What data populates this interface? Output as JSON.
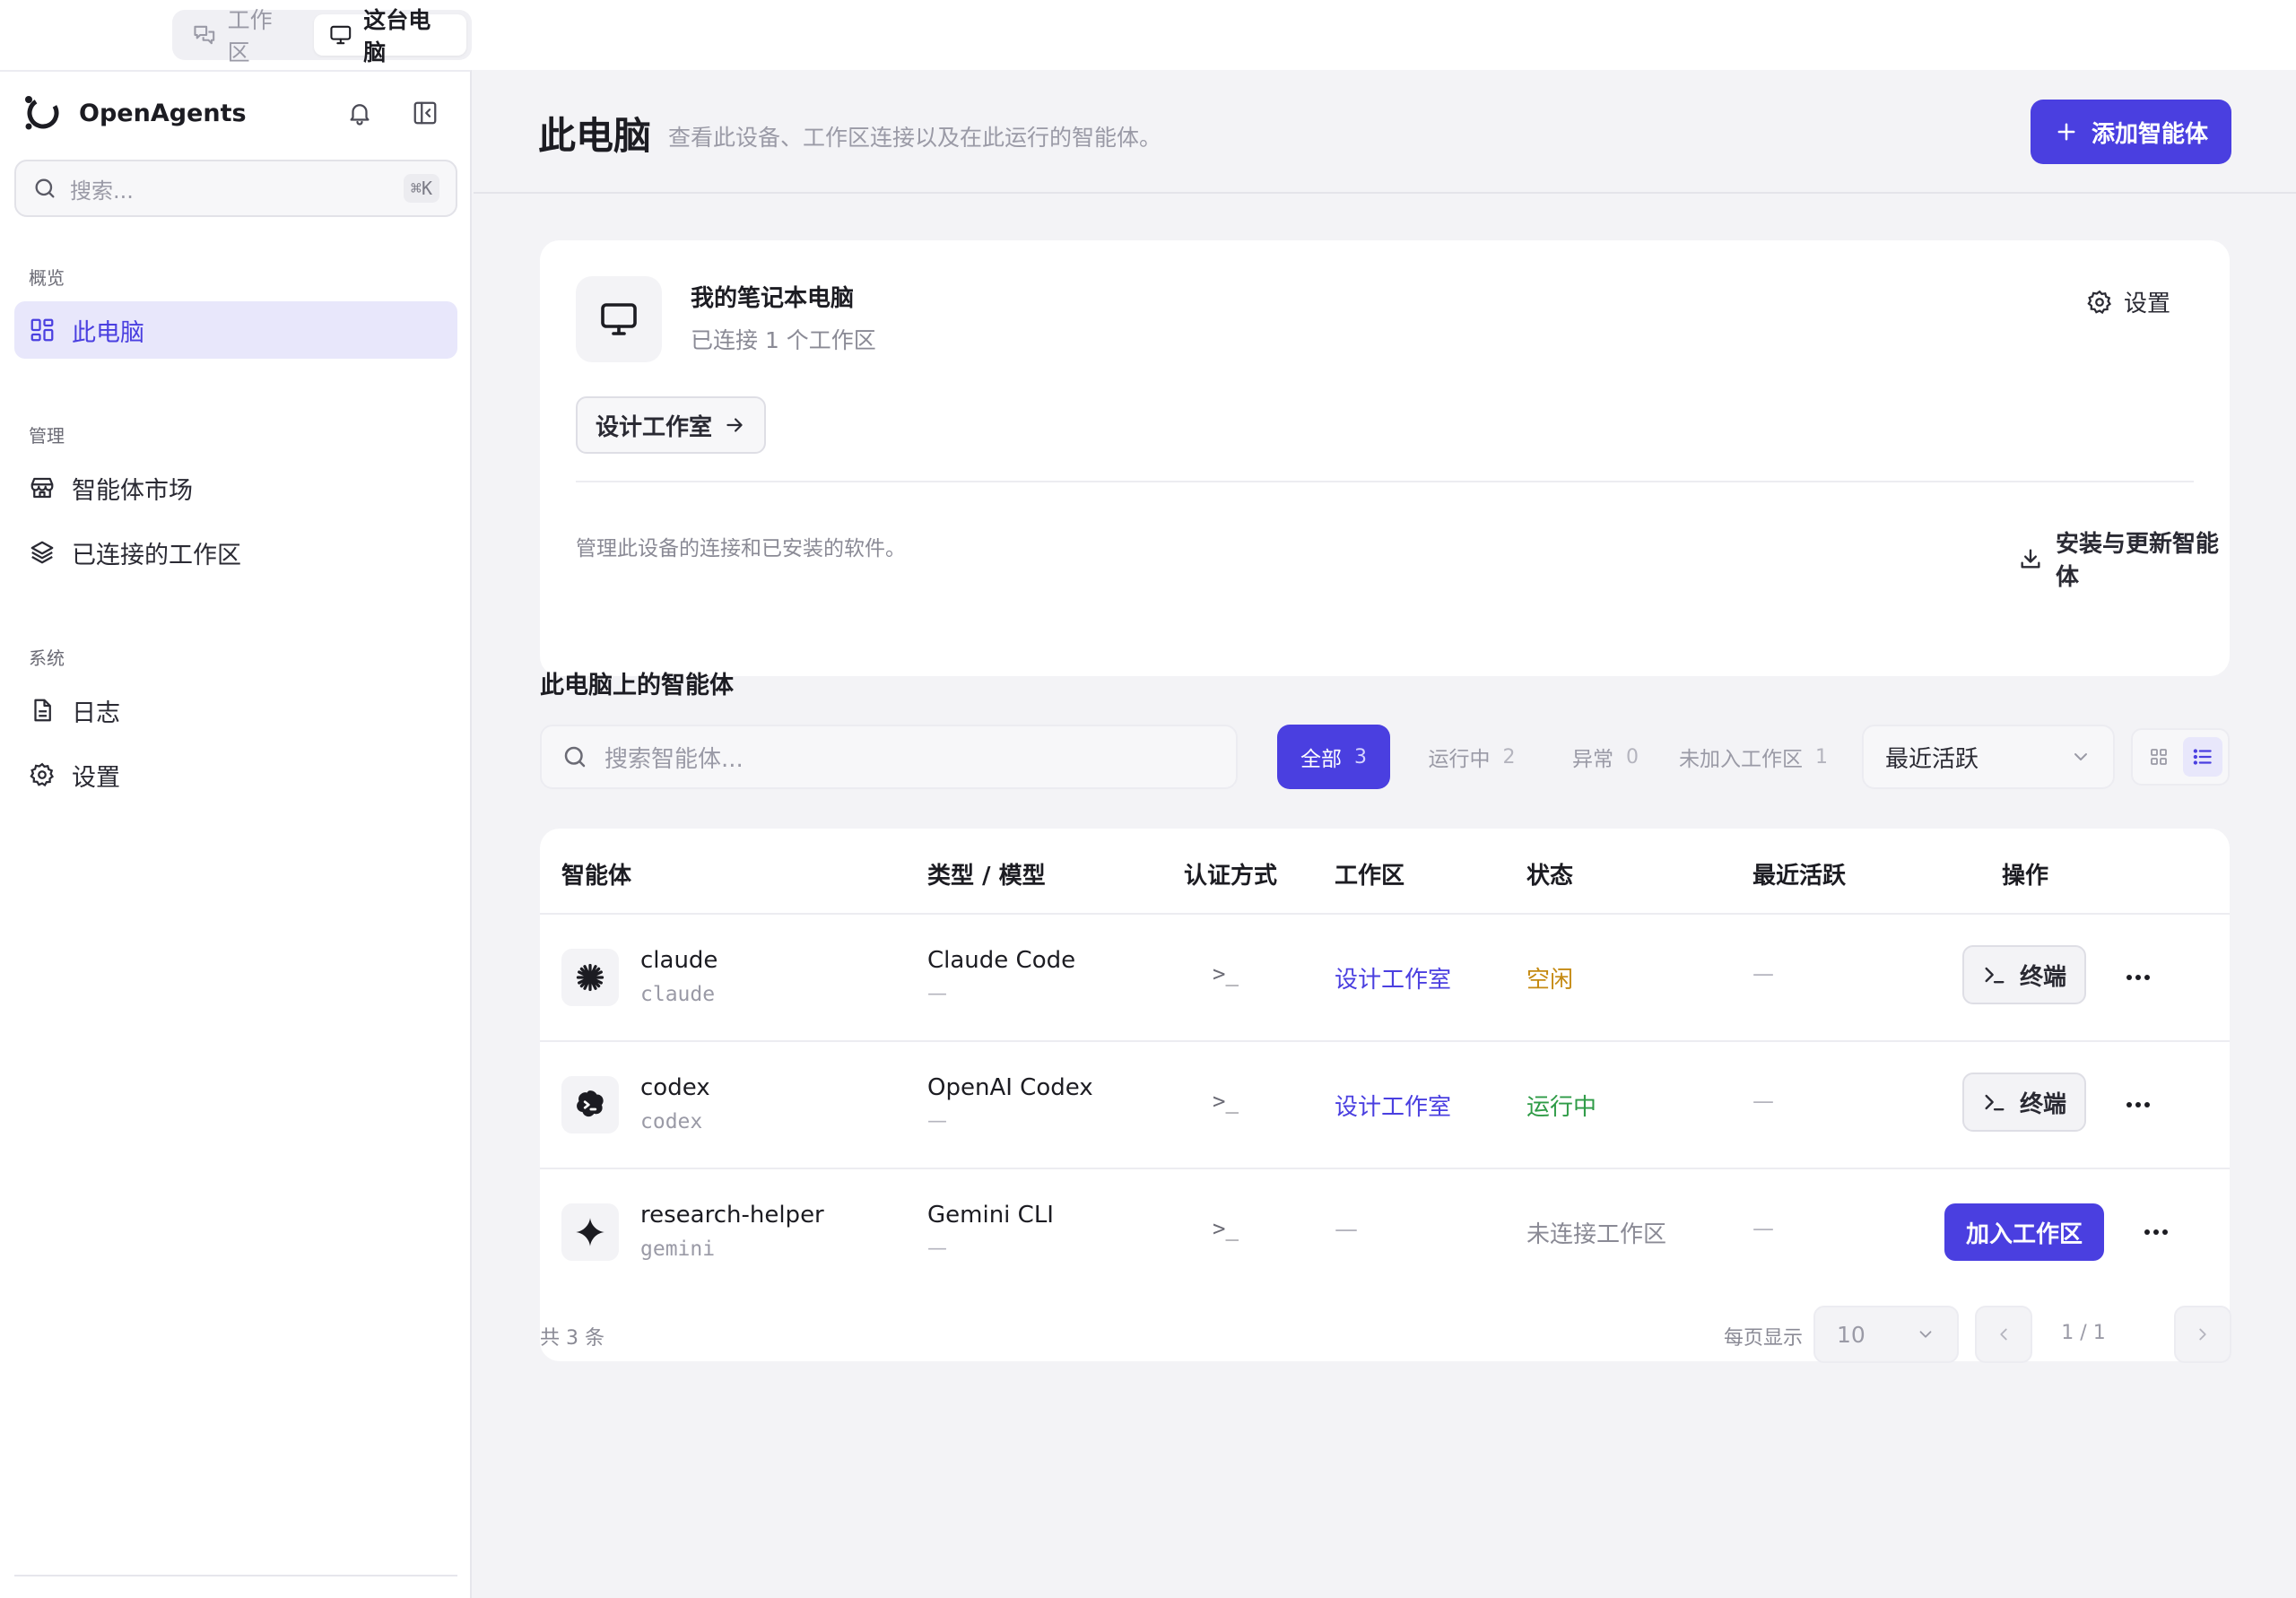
{
  "topbar": {
    "tabs": [
      {
        "label": "工作区",
        "icon": "chat-bubbles-icon",
        "active": false
      },
      {
        "label": "这台电脑",
        "icon": "monitor-icon",
        "active": true
      }
    ]
  },
  "sidebar": {
    "brand": "OpenAgents",
    "search": {
      "placeholder": "搜索...",
      "shortcut": "⌘K"
    },
    "sections": [
      {
        "label": "概览",
        "items": [
          {
            "label": "此电脑",
            "icon": "dashboard-icon",
            "active": true
          }
        ]
      },
      {
        "label": "管理",
        "items": [
          {
            "label": "智能体市场",
            "icon": "store-icon"
          },
          {
            "label": "已连接的工作区",
            "icon": "layers-icon"
          }
        ]
      },
      {
        "label": "系统",
        "items": [
          {
            "label": "日志",
            "icon": "document-icon"
          },
          {
            "label": "设置",
            "icon": "gear-icon"
          }
        ]
      }
    ]
  },
  "header": {
    "title": "此电脑",
    "subtitle": "查看此设备、工作区连接以及在此运行的智能体。",
    "add_button": "添加智能体"
  },
  "device": {
    "name": "我的笔记本电脑",
    "meta": "已连接 1 个工作区",
    "settings_label": "设置",
    "workspace_chip": "设计工作室",
    "footer_text": "管理此设备的连接和已安装的软件。",
    "install_label": "安装与更新智能体"
  },
  "agents_section": {
    "title": "此电脑上的智能体",
    "search_placeholder": "搜索智能体...",
    "filters": [
      {
        "label": "全部",
        "count": "3",
        "active": true
      },
      {
        "label": "运行中",
        "count": "2"
      },
      {
        "label": "异常",
        "count": "0"
      },
      {
        "label": "未加入工作区",
        "count": "1"
      }
    ],
    "sort": "最近活跃",
    "view_mode": "list"
  },
  "table": {
    "headers": [
      "智能体",
      "类型 / 模型",
      "认证方式",
      "工作区",
      "状态",
      "最近活跃",
      "操作"
    ],
    "rows": [
      {
        "name": "claude",
        "id": "claude",
        "type": "Claude Code",
        "model": "—",
        "auth": ">_",
        "workspace": "设计工作室",
        "status": "空闲",
        "last_active": "—",
        "action": "终端",
        "icon": "claude-asterisk-icon"
      },
      {
        "name": "codex",
        "id": "codex",
        "type": "OpenAI Codex",
        "model": "—",
        "auth": ">_",
        "workspace": "设计工作室",
        "status": "运行中",
        "last_active": "—",
        "action": "终端",
        "icon": "codex-icon"
      },
      {
        "name": "research-helper",
        "id": "gemini",
        "type": "Gemini CLI",
        "model": "—",
        "auth": ">_",
        "workspace": "—",
        "status": "未连接工作区",
        "last_active": "—",
        "action": "加入工作区",
        "icon": "gemini-sparkle-icon"
      }
    ],
    "total": "共 3 条",
    "per_page_label": "每页显示",
    "per_page": "10",
    "page": "1 / 1"
  },
  "colors": {
    "accent": "#4a3fe0",
    "idle": "#c58a12",
    "running": "#2e9b46"
  }
}
